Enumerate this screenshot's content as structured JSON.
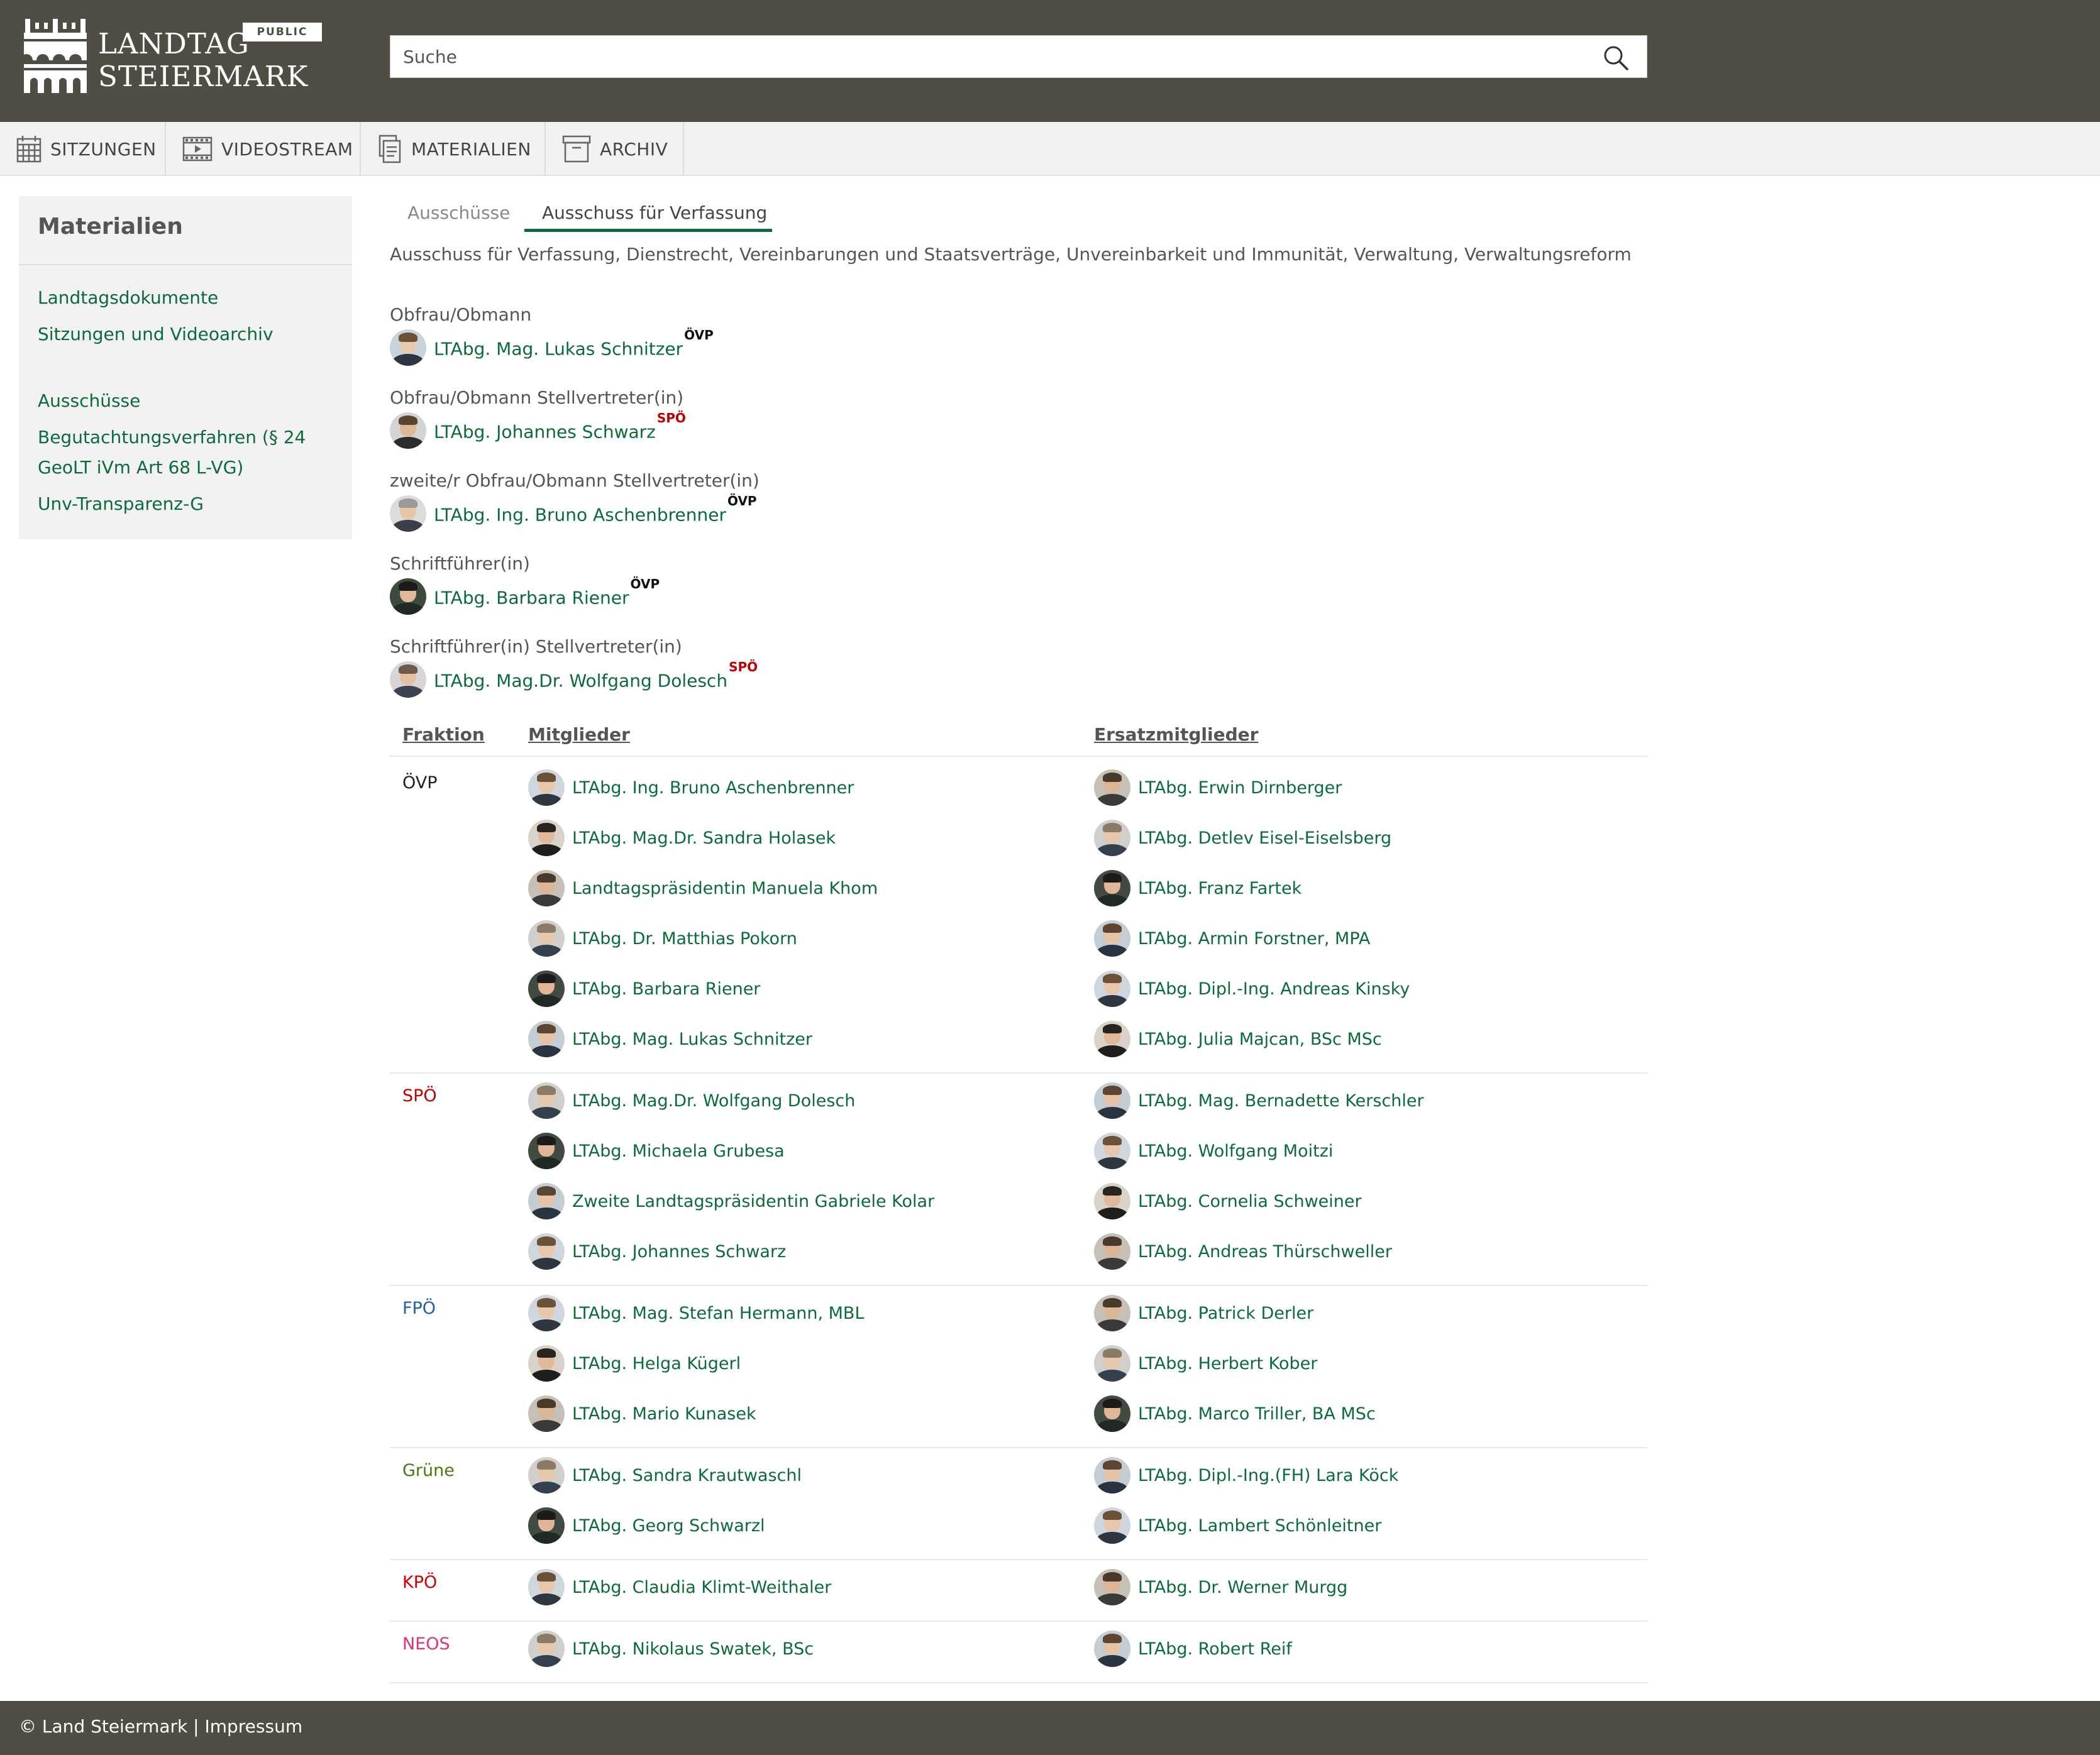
{
  "header": {
    "logo_line1": "LANDTAG",
    "logo_line2": "STEIERMARK",
    "badge": "PUBLIC",
    "search_placeholder": "Suche"
  },
  "nav": {
    "items": [
      {
        "label": "SITZUNGEN",
        "icon": "calendar-icon"
      },
      {
        "label": "VIDEOSTREAM",
        "icon": "video-icon"
      },
      {
        "label": "MATERIALIEN",
        "icon": "documents-icon"
      },
      {
        "label": "ARCHIV",
        "icon": "archive-box-icon"
      }
    ]
  },
  "sidebar": {
    "title": "Materialien",
    "links": [
      "Landtagsdokumente",
      "Sitzungen und Videoarchiv",
      "Ausschüsse",
      "Begutachtungsverfahren (§ 24 GeoLT iVm Art 68 L-VG)",
      "Unv-Transparenz-G"
    ]
  },
  "tabs": [
    "Ausschüsse",
    "Ausschuss für Verfassung"
  ],
  "committee": {
    "description": "Ausschuss für Verfassung, Dienstrecht, Vereinbarungen und Staatsverträge, Unvereinbarkeit und Immunität, Verwaltung, Verwaltungsreform",
    "roles": [
      {
        "label": "Obfrau/Obmann",
        "name": "LTAbg. Mag. Lukas Schnitzer",
        "party": "ÖVP"
      },
      {
        "label": "Obfrau/Obmann Stellvertreter(in)",
        "name": "LTAbg. Johannes Schwarz",
        "party": "SPÖ"
      },
      {
        "label": "zweite/r Obfrau/Obmann Stellvertreter(in)",
        "name": "LTAbg. Ing. Bruno Aschenbrenner",
        "party": "ÖVP"
      },
      {
        "label": "Schriftführer(in)",
        "name": "LTAbg. Barbara Riener",
        "party": "ÖVP"
      },
      {
        "label": "Schriftführer(in) Stellvertreter(in)",
        "name": "LTAbg. Mag.Dr. Wolfgang Dolesch",
        "party": "SPÖ"
      }
    ]
  },
  "table": {
    "headers": [
      "Fraktion",
      "Mitglieder",
      "Ersatzmitglieder"
    ],
    "groups": [
      {
        "party": "ÖVP",
        "color": "#222222",
        "members": [
          "LTAbg. Ing. Bruno Aschenbrenner",
          "LTAbg. Mag.Dr. Sandra Holasek",
          "Landtagspräsidentin Manuela Khom",
          "LTAbg. Dr. Matthias Pokorn",
          "LTAbg. Barbara Riener",
          "LTAbg. Mag. Lukas Schnitzer"
        ],
        "substitutes": [
          "LTAbg. Erwin Dirnberger",
          "LTAbg. Detlev Eisel-Eiselsberg",
          "LTAbg. Franz Fartek",
          "LTAbg. Armin Forstner, MPA",
          "LTAbg. Dipl.-Ing. Andreas Kinsky",
          "LTAbg. Julia Majcan, BSc MSc"
        ]
      },
      {
        "party": "SPÖ",
        "color": "#c00000",
        "members": [
          "LTAbg. Mag.Dr. Wolfgang Dolesch",
          "LTAbg. Michaela Grubesa",
          "Zweite Landtagspräsidentin Gabriele Kolar",
          "LTAbg. Johannes Schwarz"
        ],
        "substitutes": [
          "LTAbg. Mag. Bernadette Kerschler",
          "LTAbg. Wolfgang Moitzi",
          "LTAbg. Cornelia Schweiner",
          "LTAbg. Andreas Thürschweller"
        ]
      },
      {
        "party": "FPÖ",
        "color": "#1f5fa8",
        "members": [
          "LTAbg. Mag. Stefan Hermann, MBL",
          "LTAbg. Helga Kügerl",
          "LTAbg. Mario Kunasek"
        ],
        "substitutes": [
          "LTAbg. Patrick Derler",
          "LTAbg. Herbert Kober",
          "LTAbg. Marco Triller, BA MSc"
        ]
      },
      {
        "party": "Grüne",
        "color": "#4b7a0c",
        "members": [
          "LTAbg. Sandra Krautwaschl",
          "LTAbg. Georg Schwarzl"
        ],
        "substitutes": [
          "LTAbg. Dipl.-Ing.(FH) Lara Köck",
          "LTAbg. Lambert Schönleitner"
        ]
      },
      {
        "party": "KPÖ",
        "color": "#d40000",
        "members": [
          "LTAbg. Claudia Klimt-Weithaler"
        ],
        "substitutes": [
          "LTAbg. Dr. Werner Murgg"
        ]
      },
      {
        "party": "NEOS",
        "color": "#e0327a",
        "members": [
          "LTAbg. Nikolaus Swatek, BSc"
        ],
        "substitutes": [
          "LTAbg. Robert Reif"
        ]
      }
    ]
  },
  "footer": {
    "text": "© Land Steiermark | Impressum"
  }
}
